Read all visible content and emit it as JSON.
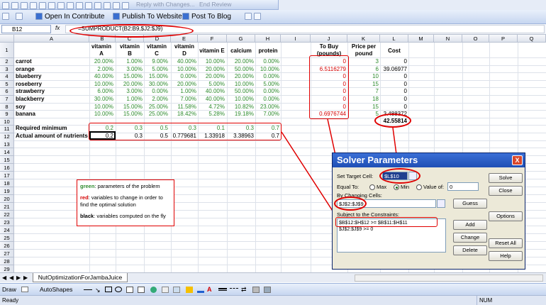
{
  "toolbar": {
    "row1_items": [
      "Reply with Changes...",
      "End Review"
    ],
    "contribute_label": "Open In Contribute",
    "publish_label": "Publish To Website",
    "blog_label": "Post To Blog"
  },
  "formula_bar": {
    "cell_ref": "B12",
    "fx": "fx",
    "formula": "=SUMPRODUCT(B2:B9,$J2:$J9)"
  },
  "columns": [
    "A",
    "B",
    "C",
    "D",
    "E",
    "F",
    "G",
    "H",
    "I",
    "J",
    "K",
    "L",
    "M",
    "N",
    "O",
    "P",
    "Q"
  ],
  "rows": [
    "1",
    "2",
    "3",
    "4",
    "5",
    "6",
    "7",
    "8",
    "9",
    "10",
    "11",
    "12",
    "13",
    "14",
    "15",
    "16",
    "17",
    "18",
    "19",
    "20",
    "21",
    "22",
    "23",
    "24",
    "25",
    "26",
    "27",
    "28",
    "29"
  ],
  "headers": {
    "b": [
      "vitamin",
      "A"
    ],
    "c": [
      "vitamin",
      "B"
    ],
    "d": [
      "vitamin",
      "C"
    ],
    "e": [
      "vitamin",
      "D"
    ],
    "f": "vitamin E",
    "g": "calcium",
    "h": "protein",
    "j": [
      "To Buy",
      "(pounds)"
    ],
    "k": [
      "Price per",
      "pound"
    ],
    "l": "Cost"
  },
  "fruits": [
    {
      "name": "carrot",
      "b": "20.00%",
      "c": "1.00%",
      "d": "9.00%",
      "e": "40.00%",
      "f": "10.00%",
      "g": "20.00%",
      "h": "0.00%",
      "j": "0",
      "k": "3",
      "l": "0"
    },
    {
      "name": "orange",
      "b": "2.00%",
      "c": "3.00%",
      "d": "5.00%",
      "e": "10.00%",
      "f": "20.00%",
      "g": "50.00%",
      "h": "10.00%",
      "j": "6.5116279",
      "k": "6",
      "l": "39.06977"
    },
    {
      "name": "blueberry",
      "b": "40.00%",
      "c": "15.00%",
      "d": "15.00%",
      "e": "0.00%",
      "f": "20.00%",
      "g": "20.00%",
      "h": "0.00%",
      "j": "0",
      "k": "10",
      "l": "0"
    },
    {
      "name": "roseberry",
      "b": "10.00%",
      "c": "20.00%",
      "d": "30.00%",
      "e": "20.00%",
      "f": "5.00%",
      "g": "10.00%",
      "h": "5.00%",
      "j": "0",
      "k": "15",
      "l": "0"
    },
    {
      "name": "strawberry",
      "b": "6.00%",
      "c": "3.00%",
      "d": "0.00%",
      "e": "1.00%",
      "f": "40.00%",
      "g": "50.00%",
      "h": "0.00%",
      "j": "0",
      "k": "7",
      "l": "0"
    },
    {
      "name": "blackberry",
      "b": "30.00%",
      "c": "1.00%",
      "d": "2.00%",
      "e": "7.00%",
      "f": "40.00%",
      "g": "10.00%",
      "h": "0.00%",
      "j": "0",
      "k": "18",
      "l": "0"
    },
    {
      "name": "soy",
      "b": "10.00%",
      "c": "15.00%",
      "d": "25.00%",
      "e": "11.58%",
      "f": "4.72%",
      "g": "10.82%",
      "h": "23.00%",
      "j": "0",
      "k": "15",
      "l": "0"
    },
    {
      "name": "banana",
      "b": "10.00%",
      "c": "15.00%",
      "d": "25.00%",
      "e": "18.42%",
      "f": "5.28%",
      "g": "19.18%",
      "h": "7.00%",
      "j": "0.6976744",
      "k": "5",
      "l": "3.488372"
    }
  ],
  "total_cost": "42.55814",
  "required": {
    "label": "Required minimum",
    "b": "0.2",
    "c": "0.3",
    "d": "0.5",
    "e": "0.3",
    "f": "0.1",
    "g": "0.3",
    "h": "0.7"
  },
  "actual": {
    "label": "Actual amount of nutrients",
    "b": "0.2",
    "c": "0.3",
    "d": "0.5",
    "e": "0.779681",
    "f": "1.33918",
    "g": "3.38963",
    "h": "0.7"
  },
  "legend": {
    "green_key": "green",
    "green_text": ": parameters of the problem",
    "red_key": "red",
    "red_text_1": ": variables to change in order to",
    "red_text_2": "find the optimal solution",
    "black_key": "black",
    "black_text": ": variables computed on the fly"
  },
  "solver": {
    "title": "Solver Parameters",
    "close": "X",
    "set_target_label": "Set Target Cell:",
    "target_value": "$L$10",
    "equal_to_label": "Equal To:",
    "max_label": "Max",
    "min_label": "Min",
    "value_of_label": "Value of:",
    "value_of_input": "0",
    "by_changing_label": "By Changing Cells:",
    "changing_value": "$J$2:$J$9",
    "guess_label": "Guess",
    "constraints_label": "Subject to the Constraints:",
    "constraints": [
      "$B$12:$H$12 >= $B$11:$H$11",
      "$J$2:$J$9 >= 0"
    ],
    "add_label": "Add",
    "change_label": "Change",
    "delete_label": "Delete",
    "solve_label": "Solve",
    "close_label": "Close",
    "options_label": "Options",
    "reset_label": "Reset All",
    "help_label": "Help"
  },
  "sheet_tab": "NutOptimizationForJambaJuice",
  "draw_toolbar": {
    "draw_label": "Draw",
    "autoshapes_label": "AutoShapes"
  },
  "status": {
    "left": "Ready",
    "right": "NUM"
  },
  "colors": {
    "green": "#2e8b2e",
    "red": "#d40000",
    "annotation": "#e00000",
    "dialog_title": "#2a5cc4"
  }
}
